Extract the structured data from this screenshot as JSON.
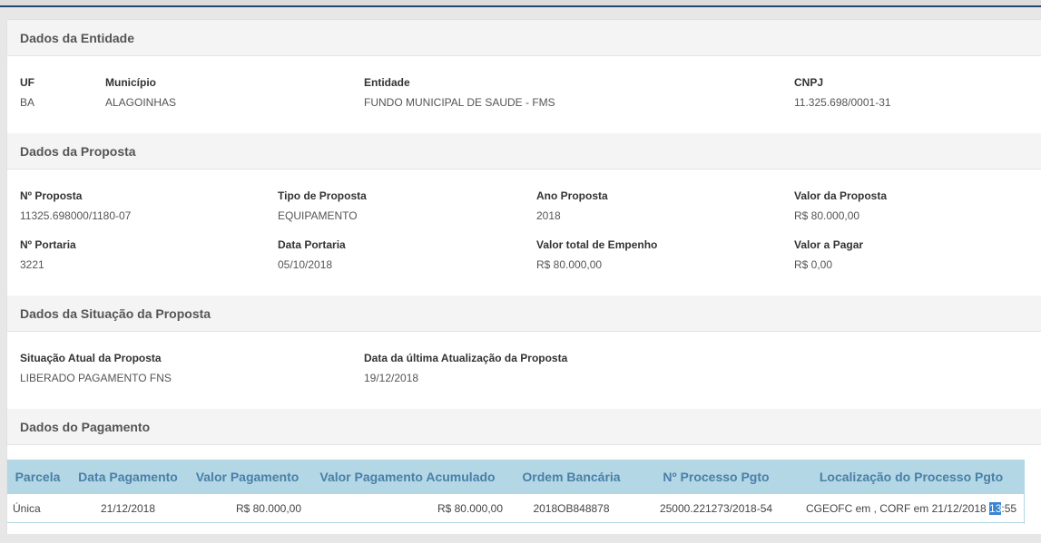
{
  "entidade": {
    "header": "Dados da Entidade",
    "uf_label": "UF",
    "uf_value": "BA",
    "municipio_label": "Município",
    "municipio_value": "ALAGOINHAS",
    "entidade_label": "Entidade",
    "entidade_value": "FUNDO MUNICIPAL DE SAUDE - FMS",
    "cnpj_label": "CNPJ",
    "cnpj_value": "11.325.698/0001-31"
  },
  "proposta": {
    "header": "Dados da Proposta",
    "numero_label": "Nº Proposta",
    "numero_value": "11325.698000/1180-07",
    "tipo_label": "Tipo de Proposta",
    "tipo_value": "EQUIPAMENTO",
    "ano_label": "Ano Proposta",
    "ano_value": "2018",
    "valor_label": "Valor da Proposta",
    "valor_value": "R$ 80.000,00",
    "portaria_label": "Nº Portaria",
    "portaria_value": "3221",
    "data_portaria_label": "Data Portaria",
    "data_portaria_value": "05/10/2018",
    "empenho_label": "Valor total de Empenho",
    "empenho_value": "R$ 80.000,00",
    "a_pagar_label": "Valor a Pagar",
    "a_pagar_value": "R$ 0,00"
  },
  "situacao": {
    "header": "Dados da Situação da Proposta",
    "atual_label": "Situação Atual da Proposta",
    "atual_value": "LIBERADO PAGAMENTO FNS",
    "atualizacao_label": "Data da última Atualização da Proposta",
    "atualizacao_value": "19/12/2018"
  },
  "pagamento": {
    "header": "Dados do Pagamento",
    "columns": [
      "Parcela",
      "Data Pagamento",
      "Valor Pagamento",
      "Valor Pagamento Acumulado",
      "Ordem Bancária",
      "Nº Processo Pgto",
      "Localização do Processo Pgto"
    ],
    "rows": [
      {
        "parcela": "Única",
        "data": "21/12/2018",
        "valor": "R$ 80.000,00",
        "acumulado": "R$ 80.000,00",
        "ordem": "2018OB848878",
        "processo": "25000.221273/2018-54",
        "localizacao_pre": "CGEOFC em , CORF em 21/12/2018 ",
        "localizacao_selected": "13",
        "localizacao_post": ":55"
      }
    ]
  }
}
